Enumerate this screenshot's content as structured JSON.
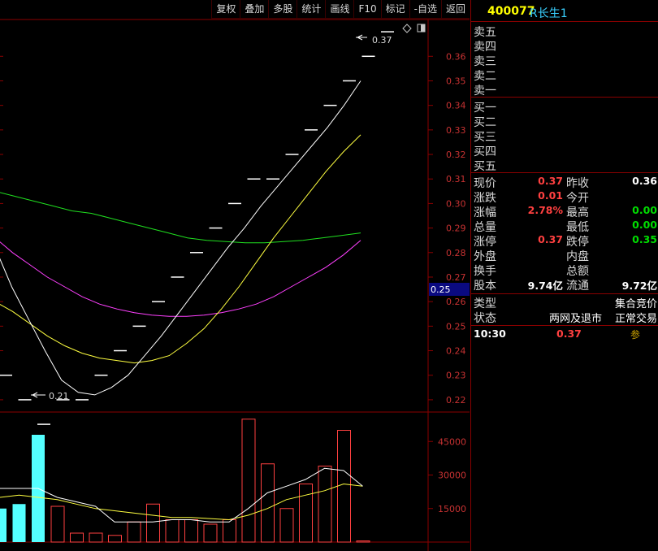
{
  "toolbar": [
    "复权",
    "叠加",
    "多股",
    "统计",
    "画线",
    "F10",
    "标记",
    "-自选",
    "返回"
  ],
  "header": {
    "code": "400077",
    "name": "R长生1"
  },
  "order_book": {
    "sell": [
      "卖五",
      "卖四",
      "卖三",
      "卖二",
      "卖一"
    ],
    "buy": [
      "买一",
      "买二",
      "买三",
      "买四",
      "买五"
    ]
  },
  "quote": [
    {
      "label": "现价",
      "value": "0.37",
      "label2": "昨收",
      "value2": "0.36",
      "c1": "#ff4040",
      "c2": "#ffffff"
    },
    {
      "label": "涨跌",
      "value": "0.01",
      "label2": "今开",
      "value2": "",
      "c1": "#ff4040",
      "c2": "#ffffff"
    },
    {
      "label": "涨幅",
      "value": "2.78%",
      "label2": "最高",
      "value2": "0.00",
      "c1": "#ff4040",
      "c2": "#00dd00"
    },
    {
      "label": "总量",
      "value": "",
      "label2": "最低",
      "value2": "0.00",
      "c1": "#ffffff",
      "c2": "#00dd00"
    },
    {
      "label": "涨停",
      "value": "0.37",
      "label2": "跌停",
      "value2": "0.35",
      "c1": "#ff4040",
      "c2": "#00dd00"
    },
    {
      "label": "外盘",
      "value": "",
      "label2": "内盘",
      "value2": "",
      "c1": "#ffffff",
      "c2": "#ffffff"
    },
    {
      "label": "换手",
      "value": "",
      "label2": "总额",
      "value2": "",
      "c1": "#ffffff",
      "c2": "#ffffff"
    },
    {
      "label": "股本",
      "value": "9.74亿",
      "label2": "流通",
      "value2": "9.72亿",
      "c1": "#ffffff",
      "c2": "#ffffff"
    }
  ],
  "status": {
    "type_label": "类型",
    "type_value": "集合竞价",
    "state_label": "状态",
    "state_value": "两网及退市",
    "state_value2": "正常交易"
  },
  "tick": {
    "time": "10:30",
    "price": "0.37",
    "flag": "参"
  },
  "colors": {
    "up": "#ff4040",
    "down": "#00dd00",
    "ma_white": "#ffffff",
    "ma_yellow": "#ffff40",
    "ma_green": "#20e020",
    "ma_magenta": "#ff40ff",
    "volume_up": "#ff4040",
    "volume_down": "#54ffff"
  },
  "chart_data": {
    "type": "line",
    "price_axis": {
      "ticks": [
        "0.36",
        "0.35",
        "0.34",
        "0.33",
        "0.32",
        "0.31",
        "0.30",
        "0.29",
        "0.28",
        "0.27",
        "0.26",
        "0.25",
        "0.24",
        "0.23",
        "0.22"
      ],
      "current": "0.25",
      "ylim": [
        0.215,
        0.375
      ]
    },
    "annotations": {
      "high": "0.37",
      "low": "0.21"
    },
    "price_bars": [
      0.23,
      0.22,
      0.21,
      0.22,
      0.22,
      0.23,
      0.24,
      0.25,
      0.26,
      0.27,
      0.28,
      0.29,
      0.3,
      0.31,
      0.31,
      0.32,
      0.33,
      0.34,
      0.35,
      0.36,
      0.37
    ],
    "ma_white": [
      0.282,
      0.266,
      0.253,
      0.24,
      0.228,
      0.223,
      0.222,
      0.225,
      0.23,
      0.238,
      0.246,
      0.255,
      0.264,
      0.273,
      0.282,
      0.29,
      0.299,
      0.307,
      0.315,
      0.323,
      0.331,
      0.34,
      0.35
    ],
    "ma_yellow": [
      0.26,
      0.256,
      0.251,
      0.246,
      0.242,
      0.239,
      0.237,
      0.236,
      0.235,
      0.236,
      0.238,
      0.243,
      0.249,
      0.257,
      0.266,
      0.276,
      0.286,
      0.295,
      0.304,
      0.313,
      0.321,
      0.328
    ],
    "ma_green": [
      0.305,
      0.303,
      0.301,
      0.299,
      0.297,
      0.296,
      0.294,
      0.292,
      0.29,
      0.288,
      0.286,
      0.285,
      0.2845,
      0.284,
      0.284,
      0.2845,
      0.285,
      0.286,
      0.287,
      0.288
    ],
    "ma_magenta": [
      0.286,
      0.28,
      0.275,
      0.27,
      0.266,
      0.262,
      0.259,
      0.257,
      0.2555,
      0.2545,
      0.254,
      0.254,
      0.2545,
      0.2555,
      0.257,
      0.259,
      0.262,
      0.266,
      0.27,
      0.274,
      0.279,
      0.285
    ],
    "volume_axis": {
      "ticks": [
        "45000",
        "30000",
        "15000"
      ],
      "ylim": [
        0,
        56000
      ]
    },
    "volume": [
      {
        "v": 15000,
        "c": "down"
      },
      {
        "v": 17000,
        "c": "down"
      },
      {
        "v": 48000,
        "c": "down"
      },
      {
        "v": 16000,
        "c": "up"
      },
      {
        "v": 4000,
        "c": "up"
      },
      {
        "v": 4000,
        "c": "up"
      },
      {
        "v": 3000,
        "c": "up"
      },
      {
        "v": 9000,
        "c": "up"
      },
      {
        "v": 17000,
        "c": "up"
      },
      {
        "v": 10000,
        "c": "up"
      },
      {
        "v": 10000,
        "c": "up"
      },
      {
        "v": 8000,
        "c": "up"
      },
      {
        "v": 10000,
        "c": "up"
      },
      {
        "v": 55000,
        "c": "up"
      },
      {
        "v": 35000,
        "c": "up"
      },
      {
        "v": 15000,
        "c": "up"
      },
      {
        "v": 26000,
        "c": "up"
      },
      {
        "v": 34000,
        "c": "up"
      },
      {
        "v": 50000,
        "c": "up"
      },
      {
        "v": 500,
        "c": "up"
      }
    ],
    "vol_ma_white": [
      24000,
      24000,
      24000,
      20000,
      18000,
      16000,
      9000,
      9000,
      9000,
      10000,
      10000,
      9000,
      9000,
      15000,
      22000,
      25000,
      28000,
      33000,
      32000,
      25000
    ],
    "vol_ma_yellow": [
      20000,
      21000,
      20000,
      19000,
      17000,
      15000,
      14000,
      13000,
      12000,
      11000,
      11000,
      10500,
      10000,
      12000,
      15000,
      19000,
      21000,
      23000,
      26000,
      25000
    ]
  }
}
